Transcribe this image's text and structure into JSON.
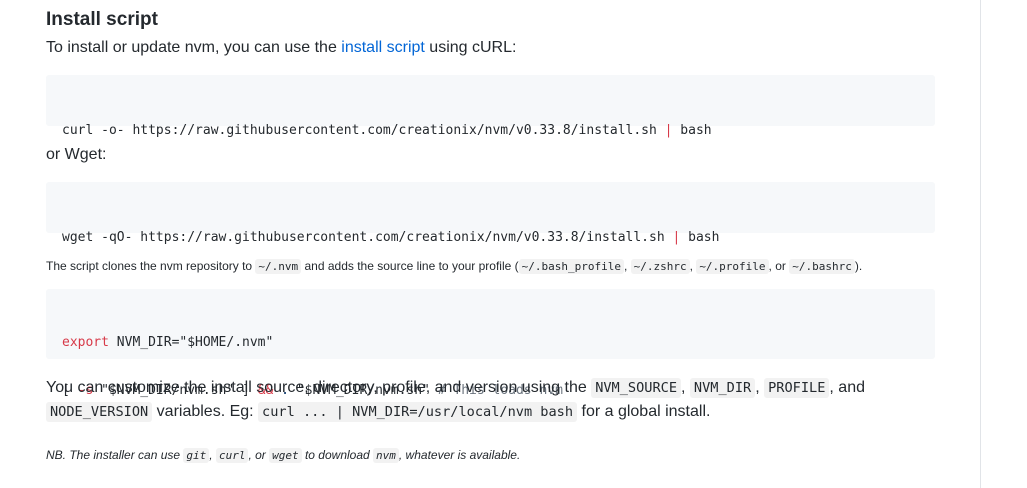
{
  "heading": "Install script",
  "intro": {
    "before": "To install or update nvm, you can use the ",
    "link": "install script",
    "after": " using cURL:"
  },
  "curl_block": {
    "cmd": "curl -o- https://raw.githubusercontent.com/creationix/nvm/v0.33.8/install.sh",
    "pipe": "|",
    "tail": " bash"
  },
  "or_wget": "or Wget:",
  "wget_block": {
    "cmd": "wget -qO- https://raw.githubusercontent.com/creationix/nvm/v0.33.8/install.sh",
    "pipe": "|",
    "tail": " bash"
  },
  "clone_note": {
    "t1": "The script clones the nvm repository to ",
    "c1": "~/.nvm",
    "t2": " and adds the source line to your profile (",
    "c2": "~/.bash_profile",
    "t3": ", ",
    "c3": "~/.zshrc",
    "t4": ", ",
    "c4": "~/.profile",
    "t5": ", or ",
    "c5": "~/.bashrc",
    "t6": ")."
  },
  "export_block": {
    "l1_kw": "export",
    "l1_rest": " NVM_DIR=\"$HOME/.nvm\"",
    "l2_a": "[ ",
    "l2_flag": "-s",
    "l2_b": " \"$NVM_DIR/nvm.sh\" ] ",
    "l2_and": "&&",
    "l2_dot": " .",
    "l2_c": " \"$NVM_DIR/nvm.sh\" ",
    "l2_comment": "# This loads nvm"
  },
  "customize": {
    "t1": "You can customize the install source, directory, profile, and version using the ",
    "c1": "NVM_SOURCE",
    "t2": ", ",
    "c2": "NVM_DIR",
    "t3": ", ",
    "c3": "PROFILE",
    "t4": ", and",
    "c4": "NODE_VERSION",
    "t5": " variables. Eg: ",
    "c5": "curl ... | NVM_DIR=/usr/local/nvm bash",
    "t6": " for a global install."
  },
  "nb": {
    "t1": "NB. The installer can use ",
    "c1": "git",
    "t2": ", ",
    "c2": "curl",
    "t3": ", or ",
    "c3": "wget",
    "t4": " to download ",
    "c4": "nvm",
    "t5": ", whatever is available."
  }
}
